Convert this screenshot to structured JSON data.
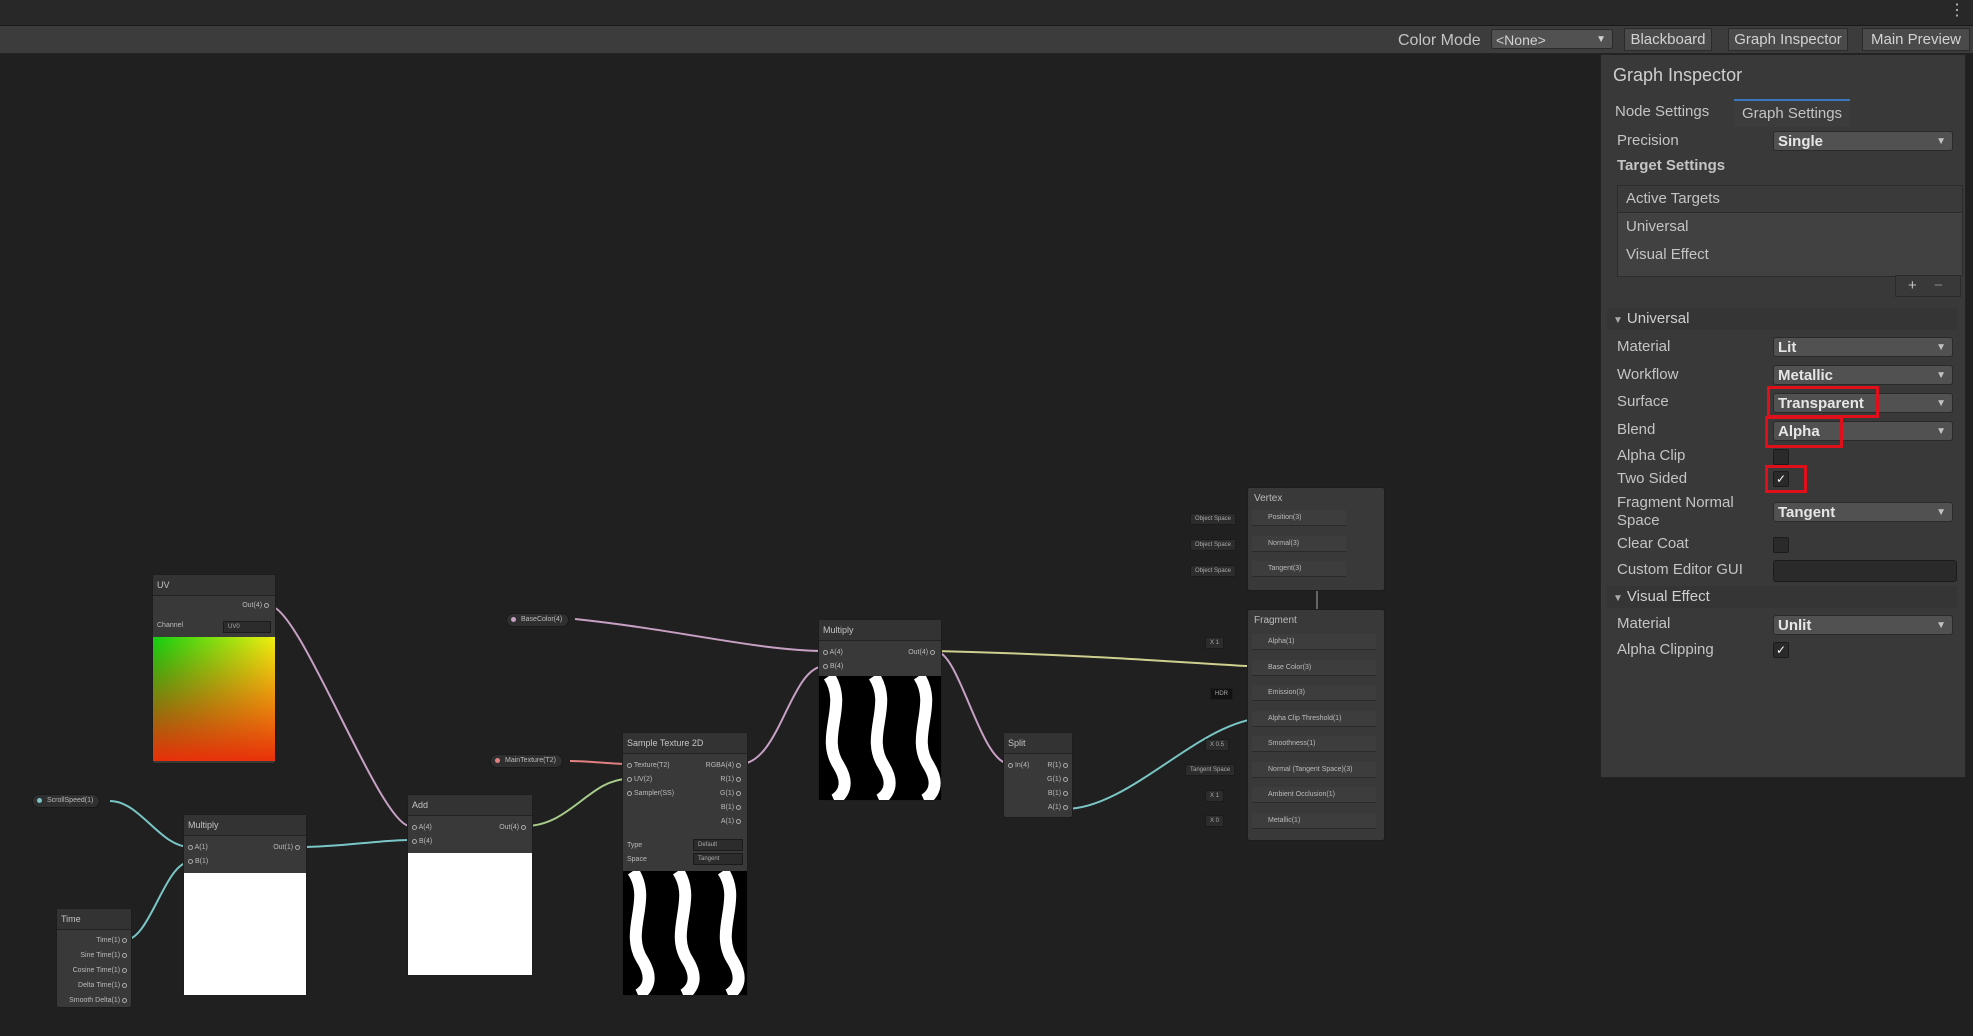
{
  "toolbar": {
    "color_mode_label": "Color Mode",
    "color_mode_value": "<None>",
    "blackboard": "Blackboard",
    "graph_inspector": "Graph Inspector",
    "main_preview": "Main Preview"
  },
  "inspector": {
    "title": "Graph Inspector",
    "tabs": [
      "Node Settings",
      "Graph Settings"
    ],
    "active_tab": "Graph Settings",
    "precision_label": "Precision",
    "precision_value": "Single",
    "target_settings": "Target Settings",
    "active_targets_header": "Active Targets",
    "targets": [
      "Universal",
      "Visual Effect"
    ],
    "add_symbol": "+",
    "remove_symbol": "−",
    "universal": {
      "section": "Universal",
      "material_label": "Material",
      "material_value": "Lit",
      "workflow_label": "Workflow",
      "workflow_value": "Metallic",
      "surface_label": "Surface",
      "surface_value": "Transparent",
      "blend_label": "Blend",
      "blend_value": "Alpha",
      "alpha_clip_label": "Alpha Clip",
      "two_sided_label": "Two Sided",
      "two_sided_checked": "✓",
      "fragment_normal_label_1": "Fragment Normal",
      "fragment_normal_label_2": "Space",
      "fragment_normal_value": "Tangent",
      "clear_coat_label": "Clear Coat",
      "custom_editor_label": "Custom Editor GUI"
    },
    "visual_effect": {
      "section": "Visual Effect",
      "material_label": "Material",
      "material_value": "Unlit",
      "alpha_clipping_label": "Alpha Clipping",
      "alpha_clipping_checked": "✓"
    }
  },
  "graph": {
    "uv_node": {
      "title": "UV",
      "out": "Out(4)",
      "channel_label": "Channel",
      "channel_value": "UV0"
    },
    "scroll_speed": "ScrollSpeed(1)",
    "base_color": "BaseColor(4)",
    "main_texture": "MainTexture(T2)",
    "time_node": {
      "title": "Time",
      "ports": [
        "Time(1)",
        "Sine Time(1)",
        "Cosine Time(1)",
        "Delta Time(1)",
        "Smooth Delta(1)"
      ]
    },
    "multiply1": {
      "title": "Multiply",
      "in": [
        "A(1)",
        "B(1)"
      ],
      "out": "Out(1)"
    },
    "add": {
      "title": "Add",
      "in": [
        "A(4)",
        "B(4)"
      ],
      "out": "Out(4)"
    },
    "sample": {
      "title": "Sample Texture 2D",
      "in": [
        "Texture(T2)",
        "UV(2)",
        "Sampler(SS)"
      ],
      "out": [
        "RGBA(4)",
        "R(1)",
        "G(1)",
        "B(1)",
        "A(1)"
      ],
      "type_label": "Type",
      "type_value": "Default",
      "space_label": "Space",
      "space_value": "Tangent"
    },
    "multiply2": {
      "title": "Multiply",
      "in": [
        "A(4)",
        "B(4)"
      ],
      "out": "Out(4)"
    },
    "split": {
      "title": "Split",
      "in": "In(4)",
      "out": [
        "R(1)",
        "G(1)",
        "B(1)",
        "A(1)"
      ]
    },
    "vertex": {
      "title": "Vertex",
      "blocks": [
        "Position(3)",
        "Normal(3)",
        "Tangent(3)"
      ],
      "ctx": [
        "Object Space",
        "Object Space",
        "Object Space"
      ]
    },
    "fragment": {
      "title": "Fragment",
      "blocks": [
        "Alpha(1)",
        "Base Color(3)",
        "Emission(3)",
        "Alpha Clip Threshold(1)",
        "Smoothness(1)",
        "Normal (Tangent Space)(3)",
        "Ambient Occlusion(1)",
        "Metallic(1)"
      ],
      "ctx": [
        "X  1",
        "",
        "HDR",
        "",
        "X  0.5",
        "Tangent Space",
        "X  1",
        "X  0"
      ]
    }
  }
}
